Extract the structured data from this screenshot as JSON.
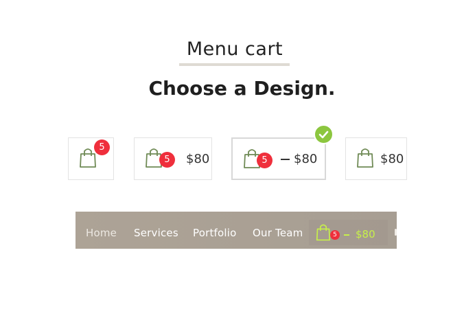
{
  "header": {
    "subtitle": "Menu cart",
    "title": "Choose a Design."
  },
  "designs": [
    {
      "name": "icon-with-badge",
      "count": "5",
      "selected": false
    },
    {
      "name": "icon-badge-price",
      "count": "5",
      "price": "$80",
      "selected": false
    },
    {
      "name": "icon-badge-dash-price",
      "count": "5",
      "dash": "–",
      "price": "$80",
      "selected": true
    },
    {
      "name": "icon-price",
      "price": "$80",
      "selected": false
    }
  ],
  "menubar": {
    "items": [
      "Home",
      "Services",
      "Portfolio",
      "Our Team"
    ],
    "cart": {
      "count": "5",
      "dash": "–",
      "price": "$80"
    }
  },
  "colors": {
    "bag_outline": "#6f8a55",
    "badge": "#ef2f3c",
    "check": "#8cc63f",
    "menu_accent": "#c7f04a"
  }
}
